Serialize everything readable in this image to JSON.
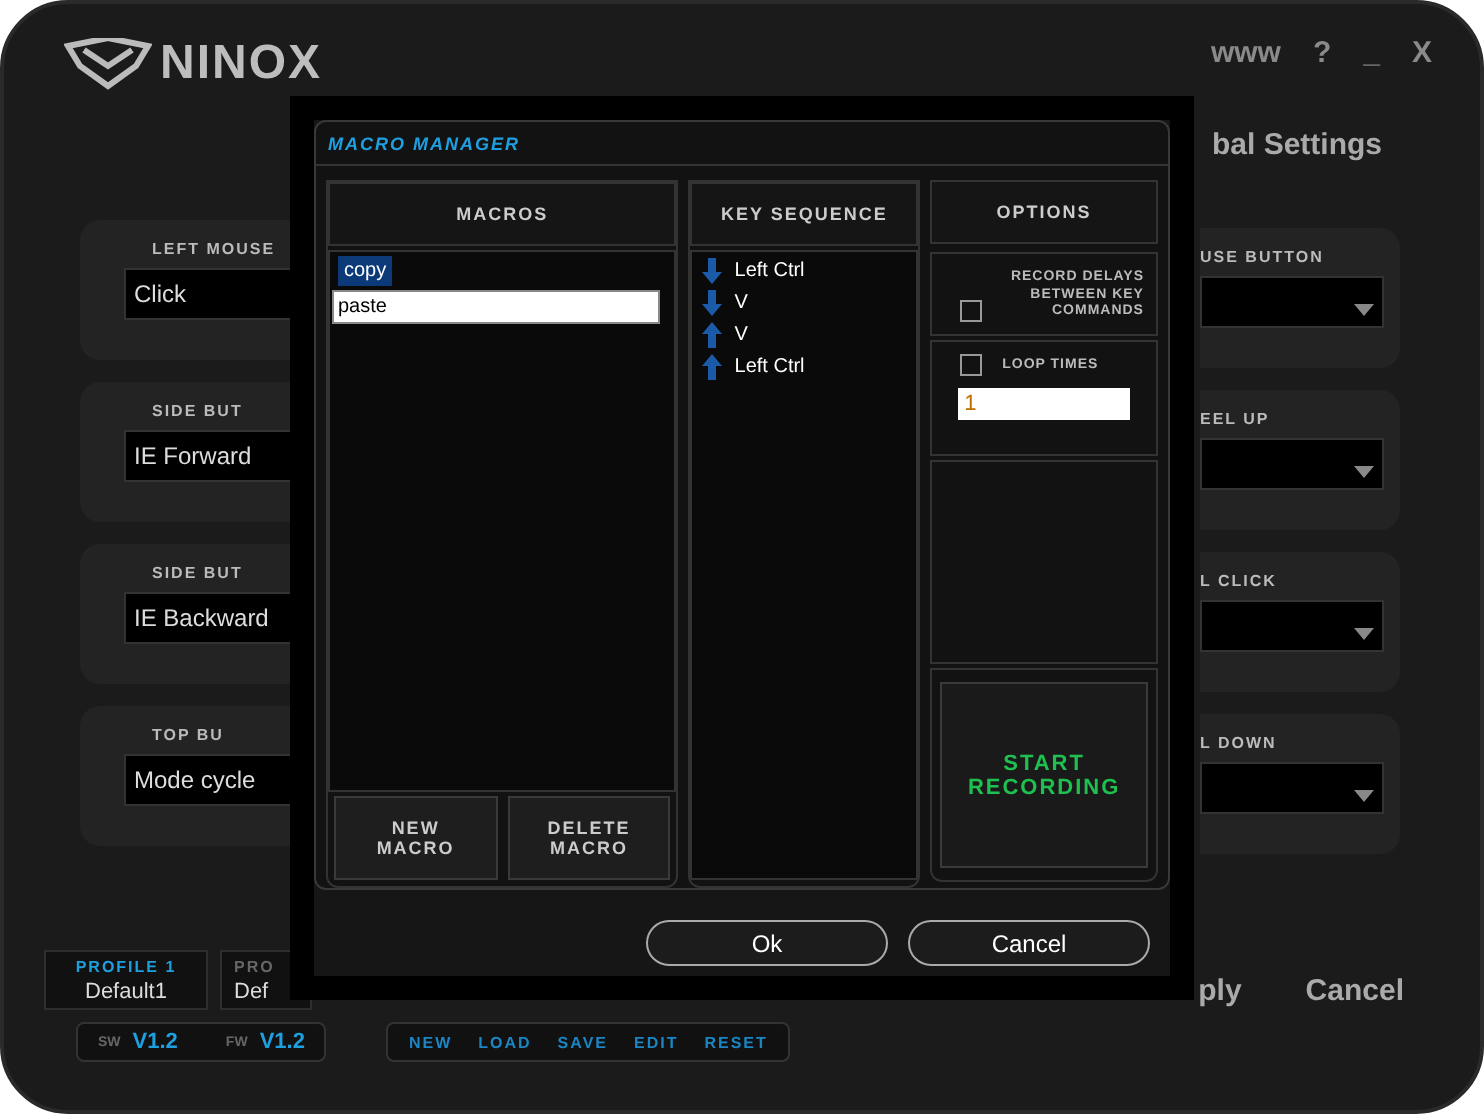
{
  "app": {
    "logo": "NINOX",
    "window_controls": [
      "www",
      "?",
      "_",
      "X"
    ],
    "tab_title": "bal Settings",
    "left_buttons": [
      {
        "label": "LEFT MOUSE",
        "value": "Click"
      },
      {
        "label": "SIDE BUT",
        "value": "IE Forward"
      },
      {
        "label": "SIDE BUT",
        "value": "IE Backward"
      },
      {
        "label": "TOP BU",
        "value": "Mode cycle"
      }
    ],
    "right_buttons": [
      {
        "label": "USE BUTTON"
      },
      {
        "label": "EEL UP"
      },
      {
        "label": "L CLICK"
      },
      {
        "label": "L DOWN"
      }
    ],
    "actions": [
      "ply",
      "Cancel"
    ],
    "profiles": [
      {
        "label": "PROFILE 1",
        "name": "Default1",
        "selected": true
      },
      {
        "label": "PRO",
        "name": "Def",
        "selected": false
      }
    ],
    "versions": [
      {
        "label": "SW",
        "value": "V1.2"
      },
      {
        "label": "FW",
        "value": "V1.2"
      }
    ],
    "menu": [
      "NEW",
      "LOAD",
      "SAVE",
      "EDIT",
      "RESET"
    ]
  },
  "dialog": {
    "title": "MACRO MANAGER",
    "macros": {
      "heading": "MACROS",
      "items": [
        {
          "label": "copy",
          "selected": true,
          "kind": "text"
        },
        {
          "label": "paste",
          "selected": false,
          "kind": "field"
        }
      ],
      "buttons": [
        "NEW\nMACRO",
        "DELETE\nMACRO"
      ]
    },
    "key_sequence": {
      "heading": "KEY SEQUENCE",
      "items": [
        {
          "key": "Left Ctrl",
          "kind": "down"
        },
        {
          "key": "V",
          "kind": "down"
        },
        {
          "key": "V",
          "kind": "up"
        },
        {
          "key": "Left Ctrl",
          "kind": "up"
        }
      ]
    },
    "options": {
      "heading": "OPTIONS",
      "record_delays": {
        "label": "RECORD DELAYS BETWEEN KEY COMMANDS",
        "checked": false
      },
      "loop": {
        "label": "LOOP TIMES",
        "checked": false,
        "value": "1"
      },
      "record_button": "START\nRECORDING"
    },
    "buttons": [
      "Ok",
      "Cancel"
    ]
  }
}
